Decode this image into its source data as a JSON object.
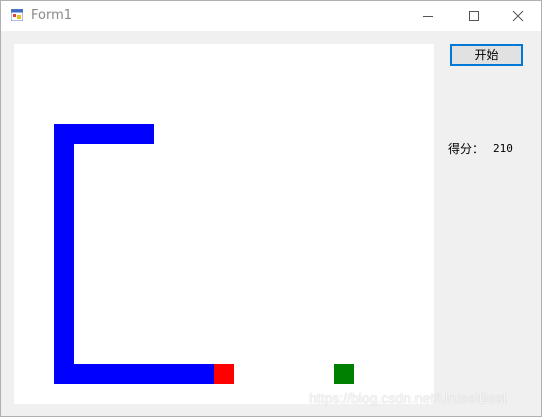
{
  "window": {
    "title": "Form1"
  },
  "controls": {
    "start_label": "开始",
    "score_label": "得分：",
    "score_value": "210"
  },
  "game": {
    "cell_size_label": "grid 20px",
    "colors": {
      "snake": "#0000ff",
      "head": "#ff0000",
      "food": "#008000",
      "board": "#ffffff"
    },
    "snake_cells": [
      [
        6,
        4
      ],
      [
        5,
        4
      ],
      [
        4,
        4
      ],
      [
        3,
        4
      ],
      [
        2,
        4
      ],
      [
        2,
        5
      ],
      [
        2,
        6
      ],
      [
        2,
        7
      ],
      [
        2,
        8
      ],
      [
        2,
        9
      ],
      [
        2,
        10
      ],
      [
        2,
        11
      ],
      [
        2,
        12
      ],
      [
        2,
        13
      ],
      [
        2,
        14
      ],
      [
        2,
        15
      ],
      [
        2,
        16
      ],
      [
        3,
        16
      ],
      [
        4,
        16
      ],
      [
        5,
        16
      ],
      [
        6,
        16
      ],
      [
        7,
        16
      ],
      [
        8,
        16
      ],
      [
        9,
        16
      ]
    ],
    "head_cell": [
      10,
      16
    ],
    "food_cell": [
      16,
      16
    ]
  },
  "watermark": {
    "text": "https://blog.csdn.net/UruseiBest"
  }
}
